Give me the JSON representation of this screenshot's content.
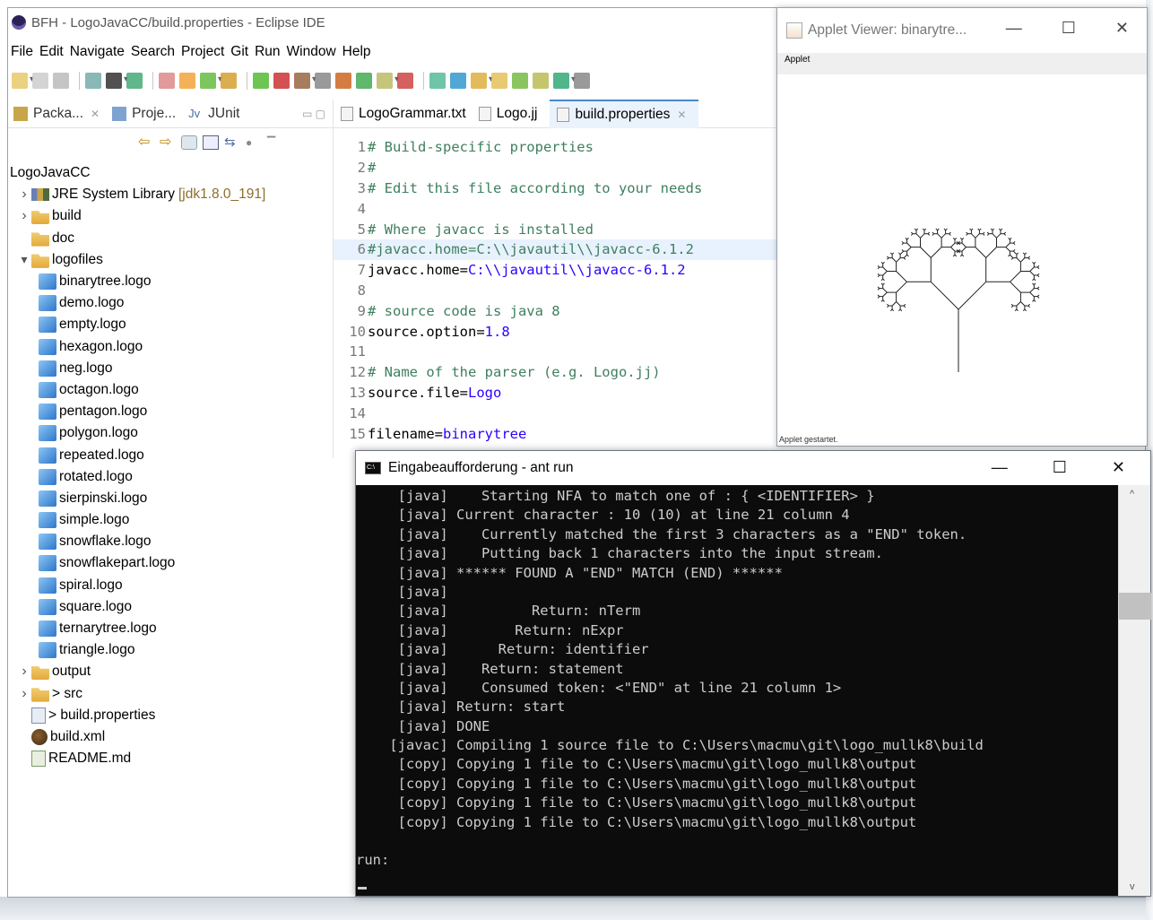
{
  "eclipse": {
    "title": "BFH - LogoJavaCC/build.properties - Eclipse IDE",
    "menu": [
      "File",
      "Edit",
      "Navigate",
      "Search",
      "Project",
      "Git",
      "Run",
      "Window",
      "Help"
    ]
  },
  "package_view": {
    "tabs": [
      {
        "label": "Packa...",
        "icon": "package-explorer-icon"
      },
      {
        "label": "Proje...",
        "icon": "project-explorer-icon"
      },
      {
        "label": "JUnit",
        "icon": "junit-icon"
      }
    ],
    "project": "LogoJavaCC",
    "items": [
      {
        "label": "JRE System Library",
        "suffix": "[jdk1.8.0_191]",
        "icon": "library-icon",
        "arrow": "›",
        "indent": 1
      },
      {
        "label": "build",
        "icon": "folder-icon",
        "arrow": "›",
        "indent": 1
      },
      {
        "label": "doc",
        "icon": "folder-icon",
        "arrow": "",
        "indent": 1
      },
      {
        "label": "logofiles",
        "icon": "folder-icon",
        "arrow": "⌄",
        "indent": 1
      },
      {
        "label": "binarytree.logo",
        "icon": "logo-file-icon",
        "indent": 2
      },
      {
        "label": "demo.logo",
        "icon": "logo-file-icon",
        "indent": 2
      },
      {
        "label": "empty.logo",
        "icon": "logo-file-icon",
        "indent": 2
      },
      {
        "label": "hexagon.logo",
        "icon": "logo-file-icon",
        "indent": 2
      },
      {
        "label": "neg.logo",
        "icon": "logo-file-icon",
        "indent": 2
      },
      {
        "label": "octagon.logo",
        "icon": "logo-file-icon",
        "indent": 2
      },
      {
        "label": "pentagon.logo",
        "icon": "logo-file-icon",
        "indent": 2
      },
      {
        "label": "polygon.logo",
        "icon": "logo-file-icon",
        "indent": 2
      },
      {
        "label": "repeated.logo",
        "icon": "logo-file-icon",
        "indent": 2
      },
      {
        "label": "rotated.logo",
        "icon": "logo-file-icon",
        "indent": 2
      },
      {
        "label": "sierpinski.logo",
        "icon": "logo-file-icon",
        "indent": 2
      },
      {
        "label": "simple.logo",
        "icon": "logo-file-icon",
        "indent": 2
      },
      {
        "label": "snowflake.logo",
        "icon": "logo-file-icon",
        "indent": 2
      },
      {
        "label": "snowflakepart.logo",
        "icon": "logo-file-icon",
        "indent": 2
      },
      {
        "label": "spiral.logo",
        "icon": "logo-file-icon",
        "indent": 2
      },
      {
        "label": "square.logo",
        "icon": "logo-file-icon",
        "indent": 2
      },
      {
        "label": "ternarytree.logo",
        "icon": "logo-file-icon",
        "indent": 2
      },
      {
        "label": "triangle.logo",
        "icon": "logo-file-icon",
        "indent": 2
      },
      {
        "label": "output",
        "icon": "folder-icon",
        "arrow": "›",
        "indent": 1
      },
      {
        "label": "> src",
        "icon": "folder-icon",
        "arrow": "›",
        "indent": 1
      },
      {
        "label": "> build.properties",
        "icon": "properties-file-icon",
        "indent": 1
      },
      {
        "label": "build.xml",
        "icon": "ant-xml-icon",
        "indent": 1
      },
      {
        "label": "README.md",
        "icon": "markdown-file-icon",
        "indent": 1
      }
    ]
  },
  "editor": {
    "tabs": [
      {
        "label": "LogoGrammar.txt",
        "active": false
      },
      {
        "label": "Logo.jj",
        "active": false
      },
      {
        "label": "build.properties",
        "active": true
      }
    ],
    "lines": [
      {
        "n": "1",
        "type": "comment",
        "text": "# Build-specific properties"
      },
      {
        "n": "2",
        "type": "comment",
        "text": "#"
      },
      {
        "n": "3",
        "type": "comment",
        "text": "# Edit this file according to your needs"
      },
      {
        "n": "4",
        "type": "blank",
        "text": ""
      },
      {
        "n": "5",
        "type": "comment",
        "text": "# Where javacc is installed"
      },
      {
        "n": "6",
        "type": "comment",
        "text": "#javacc.home=C:\\\\javautil\\\\javacc-6.1.2",
        "highlight": true
      },
      {
        "n": "7",
        "type": "prop",
        "key": "javacc.home=",
        "value": "C:\\\\javautil\\\\javacc-6.1.2"
      },
      {
        "n": "8",
        "type": "blank",
        "text": ""
      },
      {
        "n": "9",
        "type": "comment",
        "text": "# source code is java 8"
      },
      {
        "n": "10",
        "type": "prop",
        "key": "source.option=",
        "value": "1.8"
      },
      {
        "n": "11",
        "type": "blank",
        "text": ""
      },
      {
        "n": "12",
        "type": "comment",
        "text": "# Name of the parser (e.g. Logo.jj)"
      },
      {
        "n": "13",
        "type": "prop",
        "key": "source.file=",
        "value": "Logo"
      },
      {
        "n": "14",
        "type": "blank",
        "text": ""
      },
      {
        "n": "15",
        "type": "prop",
        "key": "filename=",
        "value": "binarytree"
      }
    ]
  },
  "applet": {
    "title": "Applet Viewer: binarytre...",
    "menu": "Applet",
    "status": "Applet gestartet."
  },
  "console": {
    "title": "Eingabeaufforderung - ant  run",
    "icon_label": "C:\\",
    "lines": [
      "     [java]    Starting NFA to match one of : { <IDENTIFIER> }",
      "     [java] Current character : 10 (10) at line 21 column 4",
      "     [java]    Currently matched the first 3 characters as a \"END\" token.",
      "     [java]    Putting back 1 characters into the input stream.",
      "     [java] ****** FOUND A \"END\" MATCH (END) ******",
      "     [java]",
      "     [java]          Return: nTerm",
      "     [java]        Return: nExpr",
      "     [java]      Return: identifier",
      "     [java]    Return: statement",
      "     [java]    Consumed token: <\"END\" at line 21 column 1>",
      "     [java] Return: start",
      "     [java] DONE",
      "    [javac] Compiling 1 source file to C:\\Users\\macmu\\git\\logo_mullk8\\build",
      "     [copy] Copying 1 file to C:\\Users\\macmu\\git\\logo_mullk8\\output",
      "     [copy] Copying 1 file to C:\\Users\\macmu\\git\\logo_mullk8\\output",
      "     [copy] Copying 1 file to C:\\Users\\macmu\\git\\logo_mullk8\\output",
      "     [copy] Copying 1 file to C:\\Users\\macmu\\git\\logo_mullk8\\output",
      "",
      "run:"
    ]
  },
  "colors": {
    "comment": "#3f7f5f",
    "value": "#2a00ff",
    "terminal_bg": "#0c0c0c",
    "terminal_fg": "#cccccc",
    "line_highlight": "#e8f2fe"
  }
}
